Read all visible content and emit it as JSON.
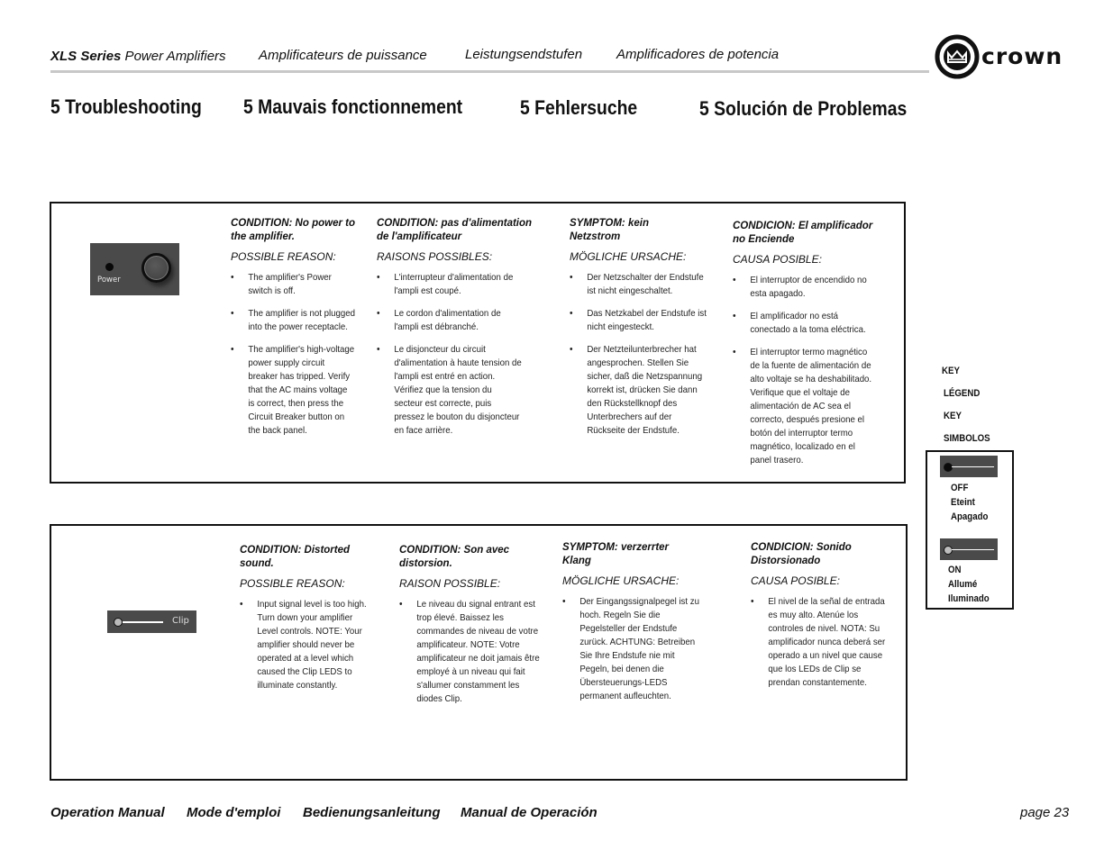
{
  "header": {
    "series_bold": "XLS Series",
    "series_rest": " Power Amplifiers",
    "fr": "Amplificateurs de puissance",
    "de": "Leistungsendstufen",
    "es": "Amplificadores de potencia",
    "logo_text": "crown",
    "logo_icon": "crown-logo-icon"
  },
  "titles": {
    "en": "5 Troubleshooting",
    "fr": "5 Mauvais fonctionnement",
    "de": "5 Fehlersuche",
    "es": "5 Solución de Problemas"
  },
  "sections": [
    {
      "device": {
        "type": "power-panel",
        "label": "Power"
      },
      "columns": [
        {
          "condition": "CONDITION: No power to the amplifier.",
          "reason_label": "POSSIBLE REASON:",
          "items": [
            "The amplifier's Power switch is off.",
            "The amplifier is not plugged into the power receptacle.",
            "The amplifier's high-voltage power supply circuit breaker has tripped. Verify that the AC mains voltage is correct, then press the Circuit Breaker button on the back panel."
          ]
        },
        {
          "condition": "CONDITION: pas d'alimentation de l'amplificateur",
          "reason_label": "RAISONS POSSIBLES:",
          "items": [
            "L'interrupteur d'alimentation de l'ampli est coupé.",
            "Le cordon d'alimentation de l'ampli est débranché.",
            "Le disjoncteur du circuit d'alimentation à haute tension de l'ampli est entré en action. Vérifiez que la tension du secteur est correcte, puis pressez le bouton du disjoncteur en face arrière."
          ]
        },
        {
          "condition": "SYMPTOM: kein Netzstrom",
          "reason_label": "MÖGLICHE URSACHE:",
          "items": [
            "Der Netzschalter der Endstufe ist nicht eingeschaltet.",
            "Das Netzkabel der Endstufe ist nicht eingesteckt.",
            "Der Netzteilunterbrecher hat angesprochen. Stellen Sie sicher, daß die Netzspannung korrekt ist, drücken Sie dann den Rückstellknopf des Unterbrechers auf der Rückseite der Endstufe."
          ]
        },
        {
          "condition": "CONDICION: El amplificador no Enciende",
          "reason_label": "CAUSA POSIBLE:",
          "items": [
            "El interruptor de encendido no esta apagado.",
            "El amplificador no está conectado a la toma eléctrica.",
            "El interruptor termo magnético de la fuente de alimentación de alto voltaje se ha deshabilitado. Verifique que el voltaje de alimentación de AC sea el correcto, después presione el botón del interruptor termo magnético, localizado en el panel trasero."
          ]
        }
      ]
    },
    {
      "device": {
        "type": "clip-panel",
        "label": "Clip"
      },
      "columns": [
        {
          "condition": "CONDITION: Distorted sound.",
          "reason_label": "POSSIBLE REASON:",
          "items": [
            "Input signal level is too high. Turn down your amplifier Level controls. NOTE: Your amplifier should never be operated at a level which caused the Clip LEDS to illuminate constantly."
          ]
        },
        {
          "condition": "CONDITION: Son avec distorsion.",
          "reason_label": "RAISON POSSIBLE:",
          "items": [
            "Le niveau du signal entrant est trop élevé. Baissez les commandes de niveau de votre amplificateur. NOTE: Votre amplificateur ne doit jamais être employé à un niveau qui fait s'allumer constamment les diodes Clip."
          ]
        },
        {
          "condition": "SYMPTOM: verzerrter Klang",
          "reason_label": "MÖGLICHE URSACHE:",
          "items": [
            "Der Eingangssignalpegel ist zu hoch. Regeln Sie die Pegelsteller der Endstufe zurück. ACHTUNG: Betreiben Sie Ihre Endstufe nie mit Pegeln, bei denen die Übersteuerungs-LEDS permanent aufleuchten."
          ]
        },
        {
          "condition": "CONDICION: Sonido Distorsionado",
          "reason_label": "CAUSA POSIBLE:",
          "items": [
            "El nivel de la señal de entrada es muy alto. Atenúe los controles de nivel. NOTA: Su amplificador nunca deberá ser operado a un nivel que cause que los LEDs de Clip se prendan constantemente."
          ]
        }
      ]
    }
  ],
  "key_legend": {
    "labels": [
      "KEY",
      "LÉGEND",
      "KEY",
      "SIMBOLOS"
    ],
    "off": {
      "lines": [
        "OFF",
        "Eteint",
        "Apagado"
      ],
      "led_color": "#0a0a0a"
    },
    "on": {
      "lines": [
        "ON",
        "Allumé",
        "Iluminado"
      ],
      "led_color": "#bdbdbd"
    }
  },
  "footer": {
    "en": "Operation Manual",
    "fr": "Mode d'emploi",
    "de": "Bedienungsanleitung",
    "es": "Manual de Operación",
    "page": "page 23"
  },
  "colors": {
    "panel_gray": "#4a4a4a",
    "header_rule": "#c8c8c8"
  }
}
